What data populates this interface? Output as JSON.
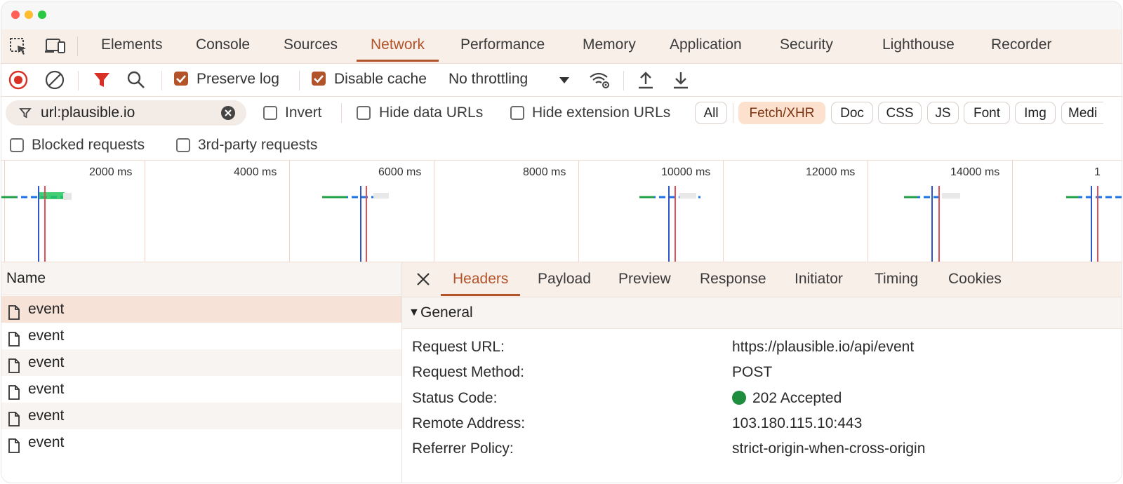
{
  "colors": {
    "accent": "#b3532a",
    "traffic_red": "#ff5f57",
    "traffic_yellow": "#febc2e",
    "traffic_green": "#28c840",
    "status_ok": "#1e8e3e"
  },
  "panel_tabs": [
    {
      "label": "Elements"
    },
    {
      "label": "Console"
    },
    {
      "label": "Sources"
    },
    {
      "label": "Network",
      "active": true
    },
    {
      "label": "Performance"
    },
    {
      "label": "Memory"
    },
    {
      "label": "Application"
    },
    {
      "label": "Security"
    },
    {
      "label": "Lighthouse"
    },
    {
      "label": "Recorder"
    }
  ],
  "toolbar": {
    "preserve_log": {
      "label": "Preserve log",
      "checked": true
    },
    "disable_cache": {
      "label": "Disable cache",
      "checked": true
    },
    "throttling": "No throttling",
    "icons": [
      "stop-recording-icon",
      "clear-icon",
      "filter-icon",
      "search-icon",
      "network-conditions-icon",
      "import-har-icon",
      "export-har-icon"
    ]
  },
  "filter": {
    "value": "url:plausible.io",
    "invert_label": "Invert",
    "hide_data_urls_label": "Hide data URLs",
    "hide_extension_urls_label": "Hide extension URLs",
    "types": [
      {
        "label": "All"
      },
      {
        "label": "Fetch/XHR",
        "active": true
      },
      {
        "label": "Doc"
      },
      {
        "label": "CSS"
      },
      {
        "label": "JS"
      },
      {
        "label": "Font"
      },
      {
        "label": "Img"
      },
      {
        "label": "Medi"
      }
    ],
    "blocked_requests_label": "Blocked requests",
    "third_party_label": "3rd-party requests"
  },
  "timeline": {
    "ticks": [
      "2000 ms",
      "4000 ms",
      "6000 ms",
      "8000 ms",
      "10000 ms",
      "12000 ms",
      "14000 ms",
      "1"
    ]
  },
  "requests": {
    "column_name": "Name",
    "rows": [
      {
        "name": "event",
        "selected": true
      },
      {
        "name": "event"
      },
      {
        "name": "event"
      },
      {
        "name": "event"
      },
      {
        "name": "event"
      },
      {
        "name": "event"
      }
    ]
  },
  "details": {
    "tabs": [
      {
        "label": "Headers",
        "active": true
      },
      {
        "label": "Payload"
      },
      {
        "label": "Preview"
      },
      {
        "label": "Response"
      },
      {
        "label": "Initiator"
      },
      {
        "label": "Timing"
      },
      {
        "label": "Cookies"
      }
    ],
    "general_title": "General",
    "fields": [
      {
        "key": "Request URL:",
        "value": "https://plausible.io/api/event"
      },
      {
        "key": "Request Method:",
        "value": "POST"
      },
      {
        "key": "Status Code:",
        "value": "202 Accepted"
      },
      {
        "key": "Remote Address:",
        "value": "103.180.115.10:443"
      },
      {
        "key": "Referrer Policy:",
        "value": "strict-origin-when-cross-origin"
      }
    ]
  }
}
